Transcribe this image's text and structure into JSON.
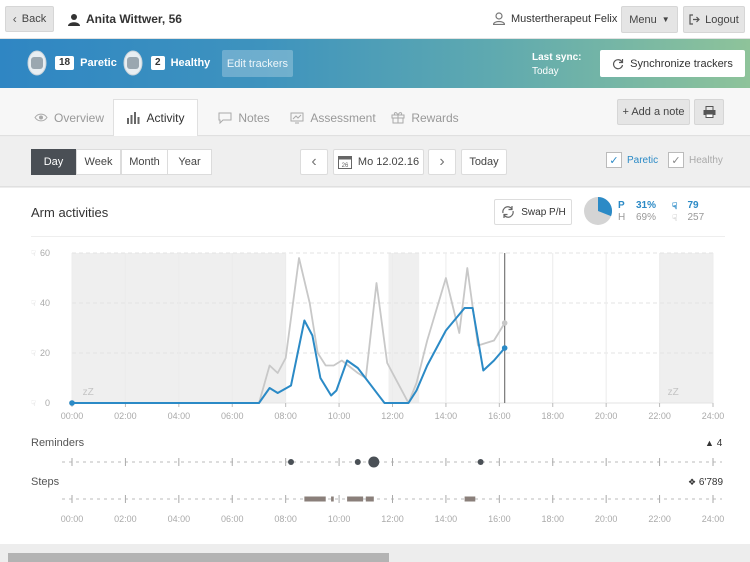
{
  "header": {
    "back_label": "Back",
    "patient_name": "Anita Wittwer, 56",
    "therapist_name": "Mustertherapeut Felix",
    "menu_label": "Menu",
    "logout_label": "Logout"
  },
  "banner": {
    "trackers": [
      {
        "count": "18",
        "label": "Paretic"
      },
      {
        "count": "2",
        "label": "Healthy"
      }
    ],
    "edit_label": "Edit trackers",
    "last_sync_label": "Last sync:",
    "last_sync_value": "Today",
    "sync_button_label": "Synchronize trackers"
  },
  "tabs": [
    {
      "label": "Overview",
      "icon": "eye-icon"
    },
    {
      "label": "Activity",
      "icon": "bar-chart-icon",
      "active": true
    },
    {
      "label": "Notes",
      "icon": "comment-icon"
    },
    {
      "label": "Assessment",
      "icon": "monitor-icon"
    },
    {
      "label": "Rewards",
      "icon": "gift-icon"
    }
  ],
  "toolbar": {
    "add_note_label": "+ Add a note",
    "print_icon": "printer-icon"
  },
  "date_nav": {
    "ranges": [
      "Day",
      "Week",
      "Month",
      "Year"
    ],
    "active_range": "Day",
    "date_label": "Mo 12.02.16",
    "calendar_day": "26",
    "today_label": "Today",
    "paretic_label": "Paretic",
    "healthy_label": "Healthy",
    "paretic_checked": true,
    "healthy_checked": true
  },
  "arm_panel": {
    "title": "Arm activities",
    "swap_label": "Swap P/H",
    "paretic_letter": "P",
    "paretic_pct": "31%",
    "paretic_count": "79",
    "healthy_letter": "H",
    "healthy_pct": "69%",
    "healthy_count": "257",
    "paretic_fraction": 0.31,
    "sleep_marks": [
      "zZ",
      "zZ"
    ]
  },
  "reminders": {
    "label": "Reminders",
    "count": "4"
  },
  "steps": {
    "label": "Steps",
    "count": "6'789"
  },
  "colors": {
    "paretic": "#2b8ac6",
    "healthy": "#c8c8c8",
    "inactive_band": "#efefef",
    "reminder_dot": "#4a5056",
    "steps_bar": "#8a7f7a"
  },
  "chart_data": {
    "type": "line",
    "title": "Arm activities",
    "xlabel": "",
    "ylabel": "",
    "xlim": [
      0,
      24
    ],
    "ylim": [
      0,
      60
    ],
    "y_ticks": [
      "0",
      "20",
      "40",
      "60"
    ],
    "x_ticks": [
      "00:00",
      "02:00",
      "04:00",
      "06:00",
      "08:00",
      "10:00",
      "12:00",
      "14:00",
      "16:00",
      "18:00",
      "20:00",
      "22:00",
      "24:00"
    ],
    "inactive_periods": [
      [
        0,
        8.0
      ],
      [
        11.85,
        13.0
      ],
      [
        22.0,
        24.0
      ]
    ],
    "current_time": 16.2,
    "series": [
      {
        "name": "Paretic",
        "x": [
          0,
          7.0,
          7.4,
          7.7,
          8.2,
          8.7,
          9.0,
          9.3,
          9.7,
          9.9,
          10.3,
          10.7,
          11.7,
          12.6,
          12.9,
          13.3,
          14.0,
          14.7,
          15.0,
          15.4,
          15.8,
          16.2
        ],
        "values": [
          0,
          0,
          6,
          4,
          7,
          33,
          27,
          10,
          3,
          5,
          17,
          14,
          0,
          0,
          5,
          15,
          29,
          38,
          38,
          13,
          17,
          22
        ]
      },
      {
        "name": "Healthy",
        "x": [
          0,
          7.0,
          7.4,
          7.7,
          8.0,
          8.5,
          8.9,
          9.2,
          9.5,
          9.8,
          10.1,
          10.7,
          11.0,
          11.4,
          11.8,
          12.6,
          12.9,
          13.3,
          14.0,
          14.5,
          14.8,
          15.2,
          15.5,
          15.8,
          16.2
        ],
        "values": [
          0,
          0,
          15,
          12,
          18,
          58,
          40,
          20,
          15,
          15,
          17,
          12,
          10,
          48,
          16,
          0,
          8,
          25,
          50,
          28,
          54,
          23,
          24,
          25,
          32
        ]
      }
    ],
    "reminders_x": [
      8.2,
      10.7,
      11.3,
      15.3
    ],
    "reminders_large": [
      false,
      false,
      true,
      false
    ],
    "steps_intervals": [
      [
        8.7,
        9.5
      ],
      [
        9.7,
        9.8
      ],
      [
        10.3,
        10.9
      ],
      [
        11.0,
        11.3
      ],
      [
        14.7,
        15.1
      ]
    ]
  }
}
